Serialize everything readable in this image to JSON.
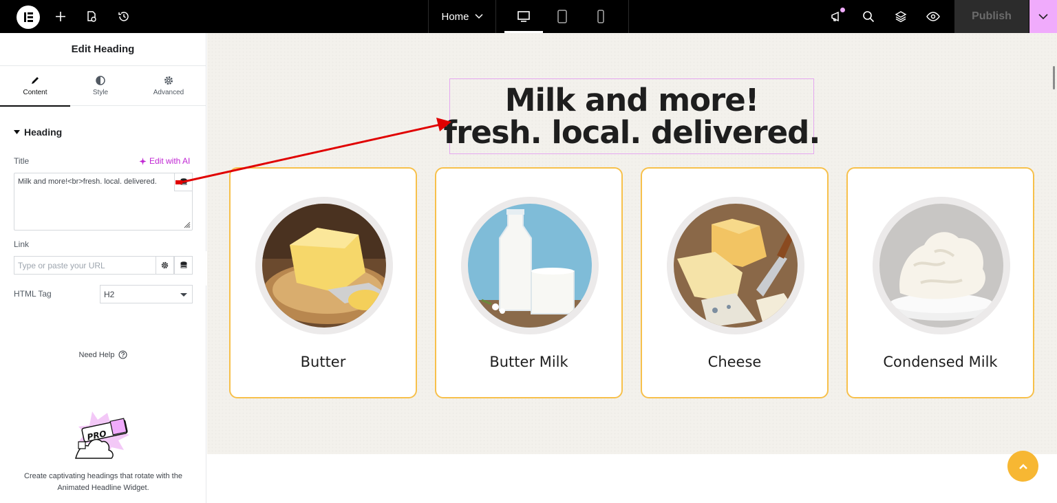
{
  "topbar": {
    "page_label": "Home",
    "publish_label": "Publish"
  },
  "panel": {
    "title": "Edit Heading",
    "tabs": [
      {
        "label": "Content",
        "icon": "pencil-icon",
        "active": true
      },
      {
        "label": "Style",
        "icon": "half-circle-icon",
        "active": false
      },
      {
        "label": "Advanced",
        "icon": "gear-icon",
        "active": false
      }
    ],
    "section_heading": "Heading",
    "title_label": "Title",
    "ai_link": "Edit with AI",
    "title_value": "Milk and more!<br>fresh. local. delivered.",
    "link_label": "Link",
    "link_placeholder": "Type or paste your URL",
    "html_tag_label": "HTML Tag",
    "html_tag_value": "H2",
    "help_label": "Need Help",
    "promo_badge": "PRO",
    "promo_text": "Create captivating headings that rotate with the Animated Headline Widget."
  },
  "canvas": {
    "heading_line1": "Milk and more!",
    "heading_line2": "fresh. local. delivered.",
    "cards": [
      {
        "title": "Butter"
      },
      {
        "title": "Butter Milk"
      },
      {
        "title": "Cheese"
      },
      {
        "title": "Condensed Milk"
      }
    ]
  },
  "colors": {
    "accent": "#c026d3",
    "selection_border": "#e5a7f0",
    "card_border": "#f7c04a",
    "annotation_arrow": "#e00000"
  }
}
